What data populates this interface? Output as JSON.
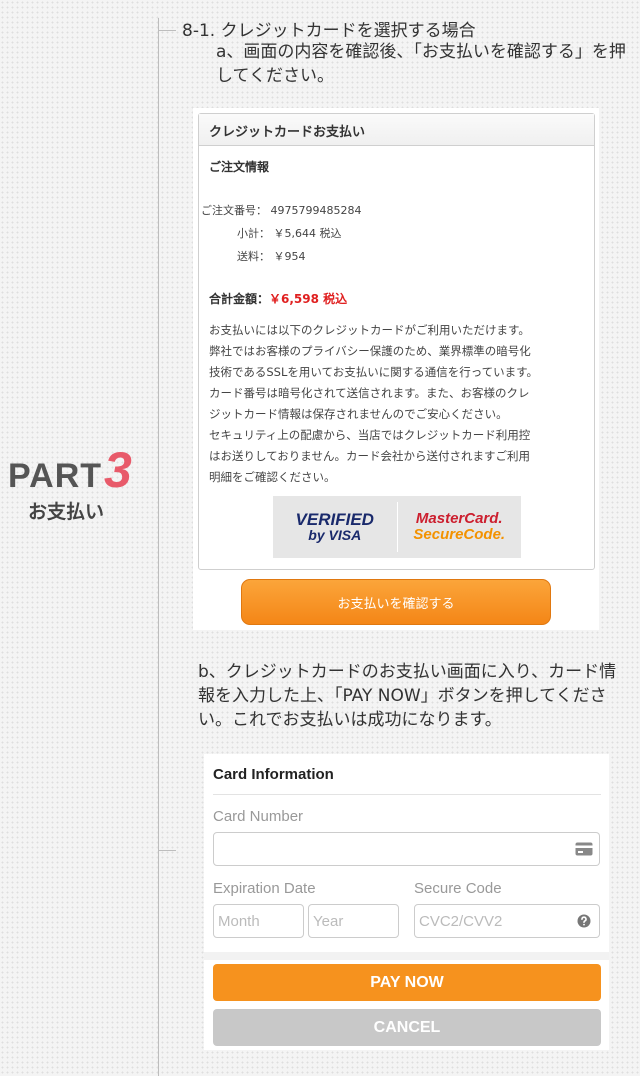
{
  "part": {
    "word": "PART",
    "number": "3",
    "subtitle": "お支払い"
  },
  "step_heading": "8-1. クレジットカードを選択する場合",
  "step_a": "a、画面の内容を確認後、「お支払いを確認する」を押してください。",
  "step_b": "b、クレジットカードのお支払い画面に入り、カード情報を入力した上、「PAY NOW」ボタンを押してください。これでお支払いは成功になります。",
  "payment_card": {
    "header": "クレジットカードお支払い",
    "order_title": "ご注文情報",
    "order_number_label": "ご注文番号：",
    "order_number": "4975799485284",
    "subtotal_label": "小計：",
    "subtotal": "￥5,644 税込",
    "shipping_label": "送料：",
    "shipping": "￥954",
    "total_label": "合計金額：",
    "total": "￥6,598 税込",
    "notice_lines": [
      "お支払いには以下のクレジットカードがご利用いただけます。",
      "弊社ではお客様のプライバシー保護のため、業界標準の暗号化",
      "技術であるSSLを用いてお支払いに関する通信を行っています。",
      "カード番号は暗号化されて送信されます。また、お客様のクレ",
      "ジットカード情報は保存されませんのでご安心ください。",
      "セキュリティ上の配慮から、当店ではクレジットカード利用控",
      "はお送りしておりません。カード会社から送付されますご利用",
      "明細をご確認ください。"
    ],
    "logo_visa_line1": "VERIFIED",
    "logo_visa_line2": "by VISA",
    "logo_mc_line1": "MasterCard.",
    "logo_mc_line2": "SecureCode."
  },
  "confirm_button": "お支払いを確認する",
  "card_info": {
    "title": "Card Information",
    "card_number_label": "Card Number",
    "card_number_value": "",
    "expiration_label": "Expiration Date",
    "month_placeholder": "Month",
    "year_placeholder": "Year",
    "secure_code_label": "Secure Code",
    "secure_code_placeholder": "CVC2/CVV2",
    "pay_now": "PAY NOW",
    "cancel": "CANCEL"
  },
  "colors": {
    "accent_orange": "#f6921e",
    "part_number_red": "#e85a6a",
    "total_red": "#e02020",
    "cancel_gray": "#c8c8c8"
  },
  "icons": [
    "credit-card-icon",
    "question-circle-icon"
  ]
}
